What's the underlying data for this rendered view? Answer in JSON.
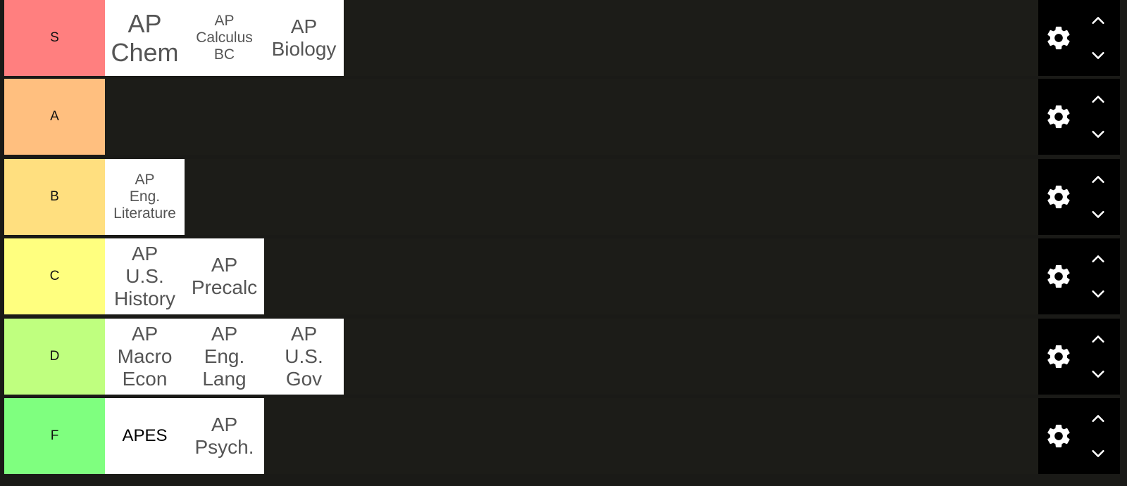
{
  "tiers": [
    {
      "label": "S",
      "color": "#ff7f7f",
      "items": [
        {
          "lines": [
            "AP",
            "Chem"
          ],
          "size": "large"
        },
        {
          "lines": [
            "AP",
            "Calculus",
            "BC"
          ],
          "size": "small"
        },
        {
          "lines": [
            "AP",
            "Biology"
          ],
          "size": "medium"
        }
      ]
    },
    {
      "label": "A",
      "color": "#ffbf7f",
      "items": []
    },
    {
      "label": "B",
      "color": "#ffdf7f",
      "items": [
        {
          "lines": [
            "AP",
            "Eng.",
            "Literature"
          ],
          "size": "small"
        }
      ]
    },
    {
      "label": "C",
      "color": "#ffff7f",
      "items": [
        {
          "lines": [
            "AP",
            "U.S.",
            "History"
          ],
          "size": "medium"
        },
        {
          "lines": [
            "AP",
            "Precalc"
          ],
          "size": "medium"
        }
      ]
    },
    {
      "label": "D",
      "color": "#bfff7f",
      "items": [
        {
          "lines": [
            "AP",
            "Macro",
            "Econ"
          ],
          "size": "medium"
        },
        {
          "lines": [
            "AP",
            "Eng.",
            "Lang"
          ],
          "size": "medium"
        },
        {
          "lines": [
            "AP",
            "U.S.",
            "Gov"
          ],
          "size": "medium"
        }
      ]
    },
    {
      "label": "F",
      "color": "#7fff7f",
      "items": [
        {
          "lines": [
            "APES"
          ],
          "size": "plain"
        },
        {
          "lines": [
            "AP",
            "Psych."
          ],
          "size": "medium"
        }
      ]
    }
  ],
  "controls": {
    "settings_icon": "gear-icon",
    "up_icon": "chevron-up-icon",
    "down_icon": "chevron-down-icon"
  },
  "colors": {
    "board_background": "#1a1a17",
    "controls_background": "#000000",
    "item_background": "#ffffff",
    "item_text": "#555555"
  }
}
